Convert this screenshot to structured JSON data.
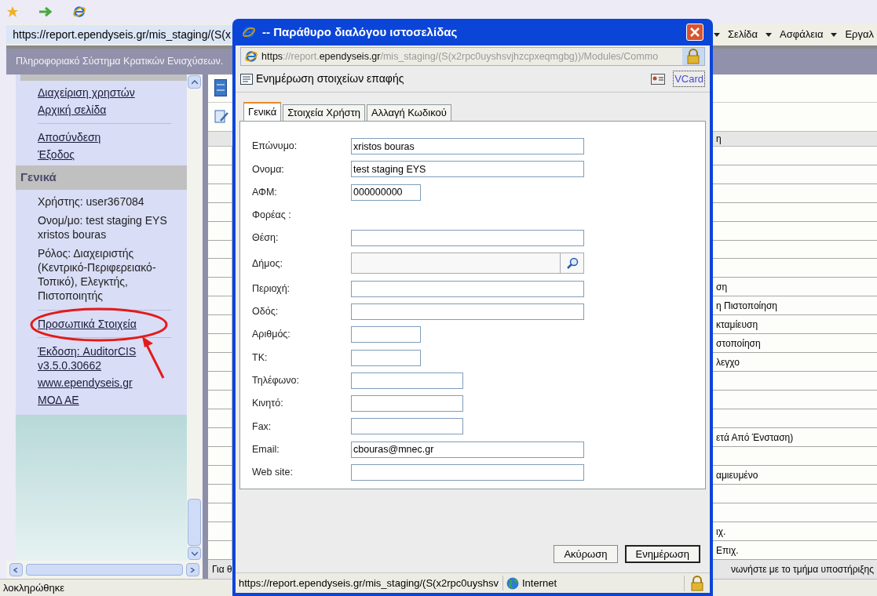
{
  "browser": {
    "address": "https://report.ependyseis.gr/mis_staging/(S(x",
    "menus": [
      "Σελίδα",
      "Ασφάλεια",
      "Εργαλ"
    ],
    "status": "λοκληρώθηκε"
  },
  "site": {
    "header": "Πληροφοριακό Σύστημα Κρατικών Ενισχύσεων.",
    "sidebar": [
      {
        "kind": "link",
        "text": "Διαχείριση χρηστών",
        "circled": false
      },
      {
        "kind": "link",
        "text": "Αρχική σελίδα",
        "circled": false
      },
      {
        "kind": "divider"
      },
      {
        "kind": "link",
        "text": "Αποσύνδεση",
        "circled": false
      },
      {
        "kind": "link",
        "text": "Έξοδος",
        "circled": false
      },
      {
        "kind": "heading",
        "text": "Γενικά"
      },
      {
        "kind": "text",
        "text": "Χρήστης: user367084"
      },
      {
        "kind": "text",
        "text": "Ονομ/μο: test staging EYS xristos bouras"
      },
      {
        "kind": "text",
        "text": "Ρόλος: Διαχειριστής (Κεντρικό-Περιφερειακό-Τοπικό), Ελεγκτής, Πιστοποιητής"
      },
      {
        "kind": "divider"
      },
      {
        "kind": "link",
        "text": "Προσωπικά Στοιχεία",
        "circled": true
      },
      {
        "kind": "divider"
      },
      {
        "kind": "link",
        "text": "Έκδοση: AuditorCIS v3.5.0.30662",
        "circled": false
      },
      {
        "kind": "link",
        "text": "www.ependyseis.gr",
        "circled": false
      },
      {
        "kind": "link",
        "text": "ΜΟΔ ΑΕ",
        "circled": false
      }
    ],
    "table": {
      "header": "η",
      "rows": [
        {
          "kind": "blank"
        },
        {
          "kind": "blank"
        },
        {
          "kind": "blank"
        },
        {
          "kind": "blank"
        },
        {
          "kind": "blank"
        },
        {
          "kind": "blank"
        },
        {
          "kind": "blank"
        },
        {
          "kind": "text",
          "text": "ση"
        },
        {
          "kind": "text",
          "text": "η Πιστοποίηση"
        },
        {
          "kind": "text",
          "text": "κταμίευση"
        },
        {
          "kind": "text",
          "text": "στοποίηση"
        },
        {
          "kind": "text",
          "text": "λεγχο"
        },
        {
          "kind": "blank"
        },
        {
          "kind": "blank"
        },
        {
          "kind": "blank"
        },
        {
          "kind": "text",
          "text": "ετά Από Ένσταση)"
        },
        {
          "kind": "blank"
        },
        {
          "kind": "text",
          "text": "αμιευμένο"
        },
        {
          "kind": "blank"
        },
        {
          "kind": "blank"
        },
        {
          "kind": "text",
          "text": "ιχ."
        },
        {
          "kind": "text",
          "text": "Επιχ."
        }
      ],
      "footer_left": "Για θ",
      "footer_right": "νωνήστε με το τμήμα υποστήριξης"
    }
  },
  "dialog": {
    "title": "-- Παράθυρο διαλόγου ιστοσελίδας",
    "address": [
      {
        "text": "https",
        "strong": true
      },
      {
        "text": "://report.",
        "strong": false
      },
      {
        "text": "ependyseis.gr",
        "strong": true
      },
      {
        "text": "/mis_staging/(S(x2rpc0uyshsvjhzcpxeqmgbg))/Modules/Commo",
        "strong": false
      }
    ],
    "heading": "Ενημέρωση στοιχείων επαφής",
    "vcard": "VCard",
    "tabs": [
      {
        "label": "Γενικά",
        "selected": true
      },
      {
        "label": "Στοιχεία Χρήστη",
        "selected": false
      },
      {
        "label": "Αλλαγή Κωδικού",
        "selected": false
      }
    ],
    "fields": [
      {
        "label": "Επώνυμο:",
        "kind": "long",
        "value": "xristos bouras"
      },
      {
        "label": "Ονομα:",
        "kind": "long",
        "value": "test staging EYS"
      },
      {
        "label": "ΑΦΜ:",
        "kind": "short",
        "value": "000000000"
      },
      {
        "label": "Φορέας :",
        "kind": "label"
      },
      {
        "label": "Θέση:",
        "kind": "long"
      },
      {
        "label": "Δήμος:",
        "kind": "lookup"
      },
      {
        "label": "Περιοχή:",
        "kind": "long"
      },
      {
        "label": "Οδός:",
        "kind": "long"
      },
      {
        "label": "Αριθμός:",
        "kind": "short"
      },
      {
        "label": "ΤΚ:",
        "kind": "short"
      },
      {
        "label": "Τηλέφωνο:",
        "kind": "medium"
      },
      {
        "label": "Κινητό:",
        "kind": "medium"
      },
      {
        "label": "Fax:",
        "kind": "medium"
      },
      {
        "label": "Email:",
        "kind": "long",
        "value": "cbouras@mnec.gr"
      },
      {
        "label": "Web site:",
        "kind": "long"
      }
    ],
    "buttons": [
      {
        "label": "Ακύρωση",
        "default": false
      },
      {
        "label": "Ενημέρωση",
        "default": true
      }
    ],
    "status": "https://report.ependyseis.gr/mis_staging/(S(x2rpc0uyshsv",
    "zone": "Internet"
  }
}
